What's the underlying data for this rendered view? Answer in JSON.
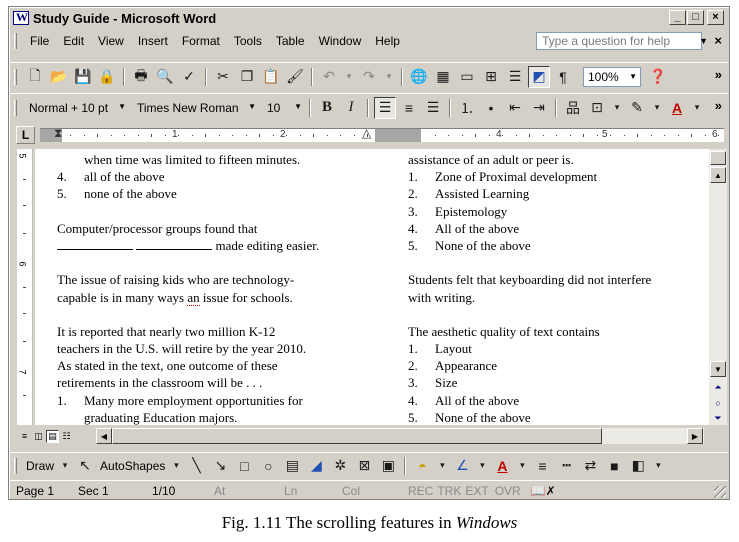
{
  "window": {
    "title": "Study Guide - Microsoft Word",
    "controls": {
      "minimize": "_",
      "maximize": "□",
      "close": "×"
    }
  },
  "menubar": {
    "items": [
      "File",
      "Edit",
      "View",
      "Insert",
      "Format",
      "Tools",
      "Table",
      "Window",
      "Help"
    ],
    "help_placeholder": "Type a question for help",
    "close_doc": "×"
  },
  "standard_toolbar": {
    "zoom": "100%",
    "icons": [
      "new-icon",
      "open-icon",
      "save-icon",
      "permission-icon",
      "print-icon",
      "print-preview-icon",
      "spelling-icon",
      "cut-icon",
      "copy-icon",
      "paste-icon",
      "format-painter-icon",
      "undo-icon",
      "redo-icon",
      "hyperlink-icon",
      "tables-borders-icon",
      "insert-table-icon",
      "insert-excel-icon",
      "columns-icon",
      "drawing-icon",
      "show-hide-icon",
      "help-icon"
    ]
  },
  "formatting_toolbar": {
    "style": "Normal + 10 pt",
    "font": "Times New Roman",
    "size": "10",
    "bold": "B",
    "italic": "I",
    "active_alignment": "align-left"
  },
  "ruler": {
    "numbers": [
      "1",
      "2",
      "3",
      "4",
      "5",
      "6"
    ]
  },
  "vertical_ruler": {
    "numbers": [
      "5",
      "6",
      "7"
    ]
  },
  "document": {
    "left_column": {
      "lines": [
        {
          "type": "indent",
          "text": "when time was limited to fifteen minutes."
        },
        {
          "type": "list",
          "num": "4.",
          "text": "all of the above"
        },
        {
          "type": "list",
          "num": "5.",
          "text": "none of the above"
        },
        {
          "type": "gap"
        },
        {
          "type": "text",
          "text": "Computer/processor groups found that"
        },
        {
          "type": "blanks",
          "text": "made editing easier."
        },
        {
          "type": "gap"
        },
        {
          "type": "text",
          "text": "The issue of raising kids who are technology-"
        },
        {
          "type": "text_squiggle",
          "before": "capable is in many ways ",
          "word": "an",
          "after": " issue for schools."
        },
        {
          "type": "gap"
        },
        {
          "type": "text",
          "text": "It is reported that nearly two million K-12"
        },
        {
          "type": "text",
          "text": "teachers in the U.S. will retire by the year 2010."
        },
        {
          "type": "text",
          "text": "As stated in the text, one outcome of these"
        },
        {
          "type": "text",
          "text": "retirements in the classroom will be . . ."
        },
        {
          "type": "list",
          "num": "1.",
          "text": "Many more employment opportunities for"
        },
        {
          "type": "indent",
          "text": "graduating Education majors."
        }
      ]
    },
    "right_column": {
      "lines": [
        {
          "type": "text",
          "text": "assistance of an adult or peer is."
        },
        {
          "type": "list",
          "num": "1.",
          "text": "Zone of Proximal development"
        },
        {
          "type": "list",
          "num": "2.",
          "text": "Assisted Learning"
        },
        {
          "type": "list",
          "num": "3.",
          "text": "Epistemology"
        },
        {
          "type": "list",
          "num": "4.",
          "text": "All of the above"
        },
        {
          "type": "list",
          "num": "5.",
          "text": "None of the above"
        },
        {
          "type": "gap"
        },
        {
          "type": "text",
          "text": "Students felt that keyboarding did not interfere"
        },
        {
          "type": "text",
          "text": "with writing."
        },
        {
          "type": "gap"
        },
        {
          "type": "text",
          "text": "The aesthetic quality of text contains"
        },
        {
          "type": "list",
          "num": "1.",
          "text": "Layout"
        },
        {
          "type": "list",
          "num": "2.",
          "text": "Appearance"
        },
        {
          "type": "list",
          "num": "3.",
          "text": "Size"
        },
        {
          "type": "list",
          "num": "4.",
          "text": "All of the above"
        },
        {
          "type": "list",
          "num": "5.",
          "text": "None of the above"
        }
      ]
    }
  },
  "drawing_toolbar": {
    "draw_label": "Draw",
    "autoshapes_label": "AutoShapes"
  },
  "statusbar": {
    "page": "Page 1",
    "section": "Sec 1",
    "page_of": "1/10",
    "at": "At",
    "line": "Ln",
    "col": "Col",
    "rec": "REC",
    "trk": "TRK",
    "ext": "EXT",
    "ovr": "OVR"
  },
  "caption": {
    "prefix": "Fig. 1.11 The scrolling features in ",
    "emphasis": "Windows"
  }
}
